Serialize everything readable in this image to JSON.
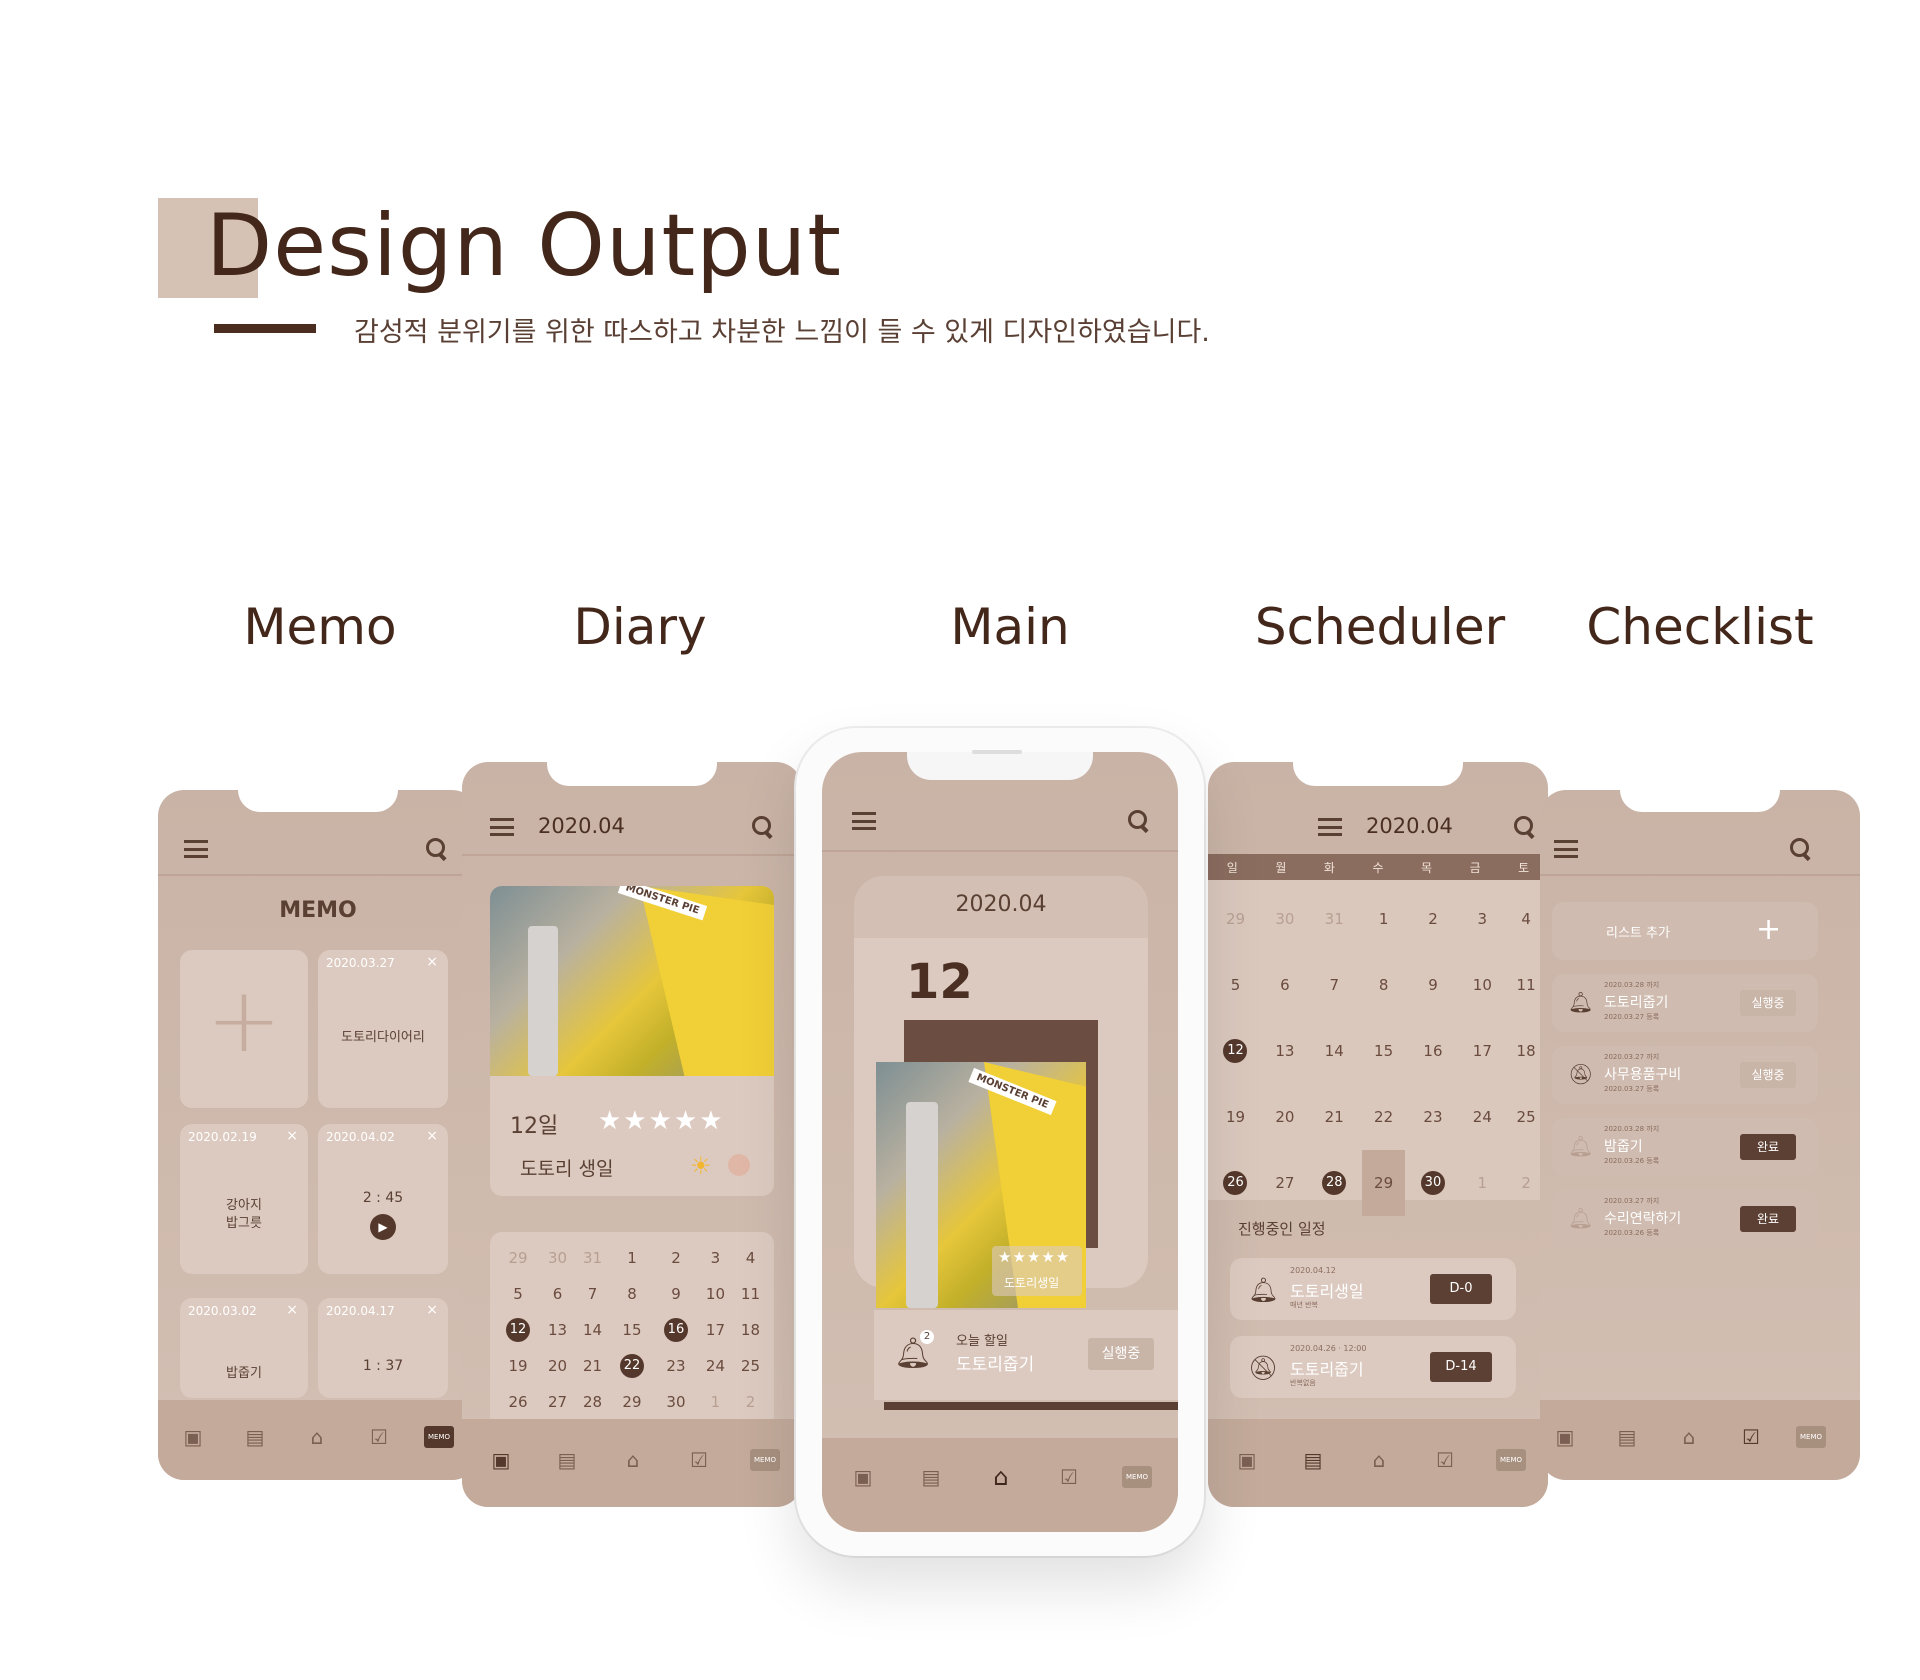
{
  "header": {
    "title": "Design Output",
    "subtitle": "감성적 분위기를 위한 따스하고 차분한 느낌이 들 수 있게 디자인하였습니다."
  },
  "labels": [
    "Memo",
    "Diary",
    "Main",
    "Scheduler",
    "Checklist"
  ],
  "memo": {
    "title": "MEMO",
    "cards": [
      {
        "date": "2020.03.27",
        "text": "도토리다이어리"
      },
      {
        "date": "2020.02.19",
        "text1": "강아지",
        "text2": "밥그릇"
      },
      {
        "date": "2020.04.02",
        "time": "2 : 45"
      },
      {
        "date": "2020.03.02",
        "text": "밥줍기"
      },
      {
        "date": "2020.04.17",
        "time": "1 : 37"
      }
    ],
    "add": "+",
    "close": "×",
    "nav_memo_label": "MEMO"
  },
  "diary": {
    "month": "2020.04",
    "day": "12일",
    "stars": "★★★★★",
    "entry": "도토리 생일",
    "sticker": "MONSTER PIE",
    "calendar": [
      [
        "29",
        "30",
        "31",
        "1",
        "2",
        "3",
        "4"
      ],
      [
        "5",
        "6",
        "7",
        "8",
        "9",
        "10",
        "11"
      ],
      [
        "12",
        "13",
        "14",
        "15",
        "16",
        "17",
        "18"
      ],
      [
        "19",
        "20",
        "21",
        "22",
        "23",
        "24",
        "25"
      ],
      [
        "26",
        "27",
        "28",
        "29",
        "30",
        "1",
        "2"
      ]
    ],
    "nav_memo_label": "MEMO"
  },
  "main": {
    "month": "2020.04",
    "day": "12",
    "stars": "★★★★★",
    "caption": "도토리생일",
    "sticker": "MONSTER PIE",
    "todo_label": "오늘 할일",
    "todo_title": "도토리줍기",
    "todo_status": "실행중",
    "badge": "2",
    "nav_memo_label": "MEMO"
  },
  "scheduler": {
    "month": "2020.04",
    "weekdays": [
      "일",
      "월",
      "화",
      "수",
      "목",
      "금",
      "토"
    ],
    "calendar": [
      [
        "29",
        "30",
        "31",
        "1",
        "2",
        "3",
        "4"
      ],
      [
        "5",
        "6",
        "7",
        "8",
        "9",
        "10",
        "11"
      ],
      [
        "12",
        "13",
        "14",
        "15",
        "16",
        "17",
        "18"
      ],
      [
        "19",
        "20",
        "21",
        "22",
        "23",
        "24",
        "25"
      ],
      [
        "26",
        "27",
        "28",
        "29",
        "30",
        "1",
        "2"
      ]
    ],
    "section": "진행중인 일정",
    "events": [
      {
        "date": "2020.04.12",
        "title": "도토리생일",
        "note": "매년 반복",
        "dday": "D-0"
      },
      {
        "date": "2020.04.26 · 12:00",
        "title": "도토리줍기",
        "note": "반복없음",
        "dday": "D-14"
      }
    ],
    "nav_memo_label": "MEMO"
  },
  "checklist": {
    "add_label": "리스트 추가",
    "add_icon": "+",
    "items": [
      {
        "due": "2020.03.28 까지",
        "title": "도토리줍기",
        "created": "2020.03.27 등록",
        "status": "실행중",
        "done": false
      },
      {
        "due": "2020.03.27 까지",
        "title": "사무용품구비",
        "created": "2020.03.27 등록",
        "status": "실행중",
        "done": false
      },
      {
        "due": "2020.03.28 까지",
        "title": "밤줍기",
        "created": "2020.03.26 등록",
        "status": "완료",
        "done": true
      },
      {
        "due": "2020.03.27 까지",
        "title": "수리연락하기",
        "created": "2020.03.26 등록",
        "status": "완료",
        "done": true
      }
    ],
    "nav_memo_label": "MEMO"
  },
  "colors": {
    "accent": "#d6c2b4",
    "dark": "#43271a",
    "phone": "#c9b3a6",
    "button": "#5c4033"
  }
}
